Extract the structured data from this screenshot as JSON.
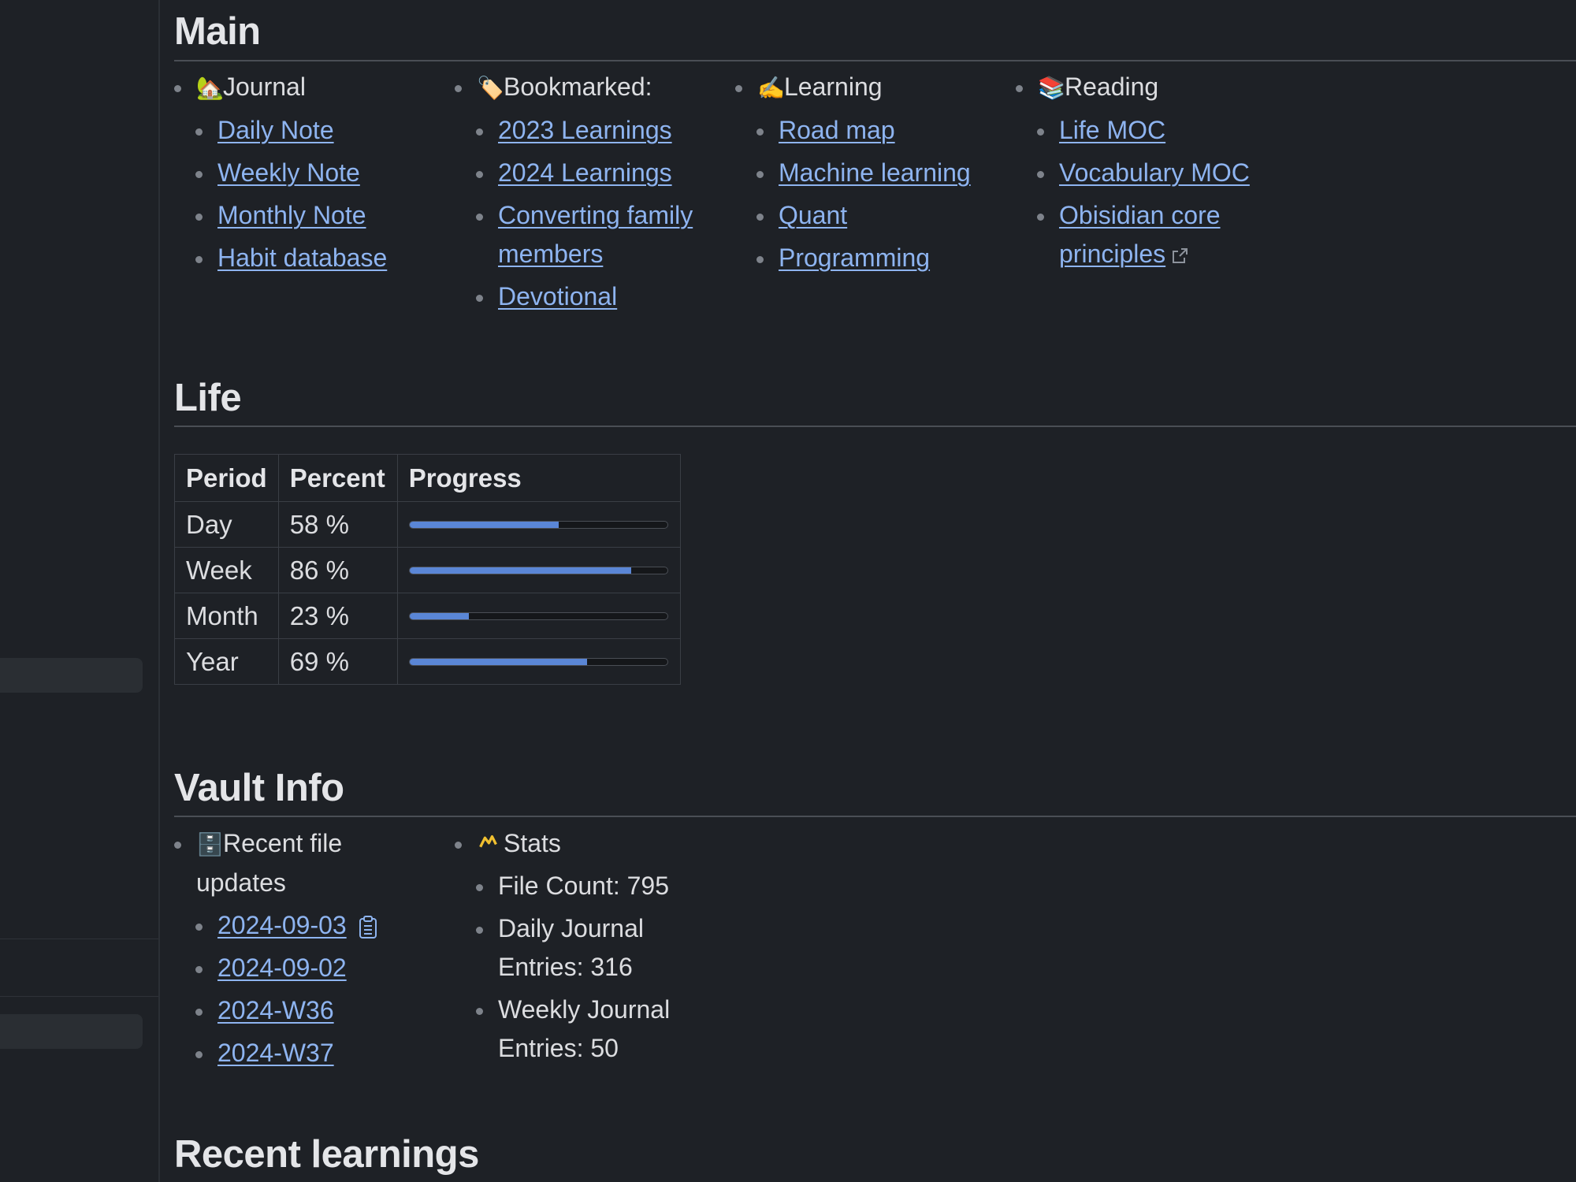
{
  "sections": {
    "main": "Main",
    "life": "Life",
    "vault": "Vault Info",
    "recent": "Recent learnings"
  },
  "main_columns": [
    {
      "icon": "🏡",
      "title": "Journal",
      "links": [
        "Daily Note",
        "Weekly Note",
        "Monthly Note",
        "Habit database"
      ]
    },
    {
      "icon": "🏷️",
      "title": "Bookmarked:",
      "links": [
        "2023 Learnings",
        "2024 Learnings",
        "Converting family members",
        "Devotional"
      ]
    },
    {
      "icon": "✍️",
      "title": "Learning",
      "links": [
        "Road map",
        "Machine learning",
        "Quant",
        "Programming"
      ]
    },
    {
      "icon": "📚",
      "title": "Reading",
      "links": [
        "Life MOC",
        "Vocabulary MOC",
        "Obisidian core principles"
      ]
    }
  ],
  "life_table": {
    "headers": [
      "Period",
      "Percent",
      "Progress"
    ],
    "rows": [
      {
        "period": "Day",
        "percent": "58 %",
        "progress": 0.58
      },
      {
        "period": "Week",
        "percent": "86 %",
        "progress": 0.86
      },
      {
        "period": "Month",
        "percent": "23 %",
        "progress": 0.23
      },
      {
        "period": "Year",
        "percent": "69 %",
        "progress": 0.69
      }
    ]
  },
  "vault": {
    "recent": {
      "icon": "🗄️",
      "title": "Recent file updates",
      "links": [
        "2024-09-03",
        "2024-09-02",
        "2024-W36",
        "2024-W37"
      ]
    },
    "stats": {
      "title": "Stats",
      "items": [
        "File Count: 795",
        "Daily Journal Entries: 316",
        "Weekly Journal Entries: 50"
      ]
    }
  },
  "colors": {
    "link": "#8eb4f0",
    "progress_fill": "#5a86d6",
    "stats_icon": "#f0c030"
  }
}
